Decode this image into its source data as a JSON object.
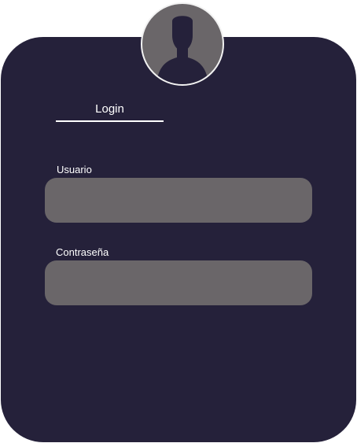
{
  "login": {
    "tab_label": "Login",
    "username": {
      "label": "Usuario",
      "value": "",
      "placeholder": ""
    },
    "password": {
      "label": "Contraseña",
      "value": "",
      "placeholder": ""
    }
  },
  "icons": {
    "avatar": "user-silhouette-icon"
  },
  "colors": {
    "card": "#25213a",
    "field": "#6a6669",
    "text": "#ffffff",
    "avatar_border": "#f2f2f2"
  }
}
